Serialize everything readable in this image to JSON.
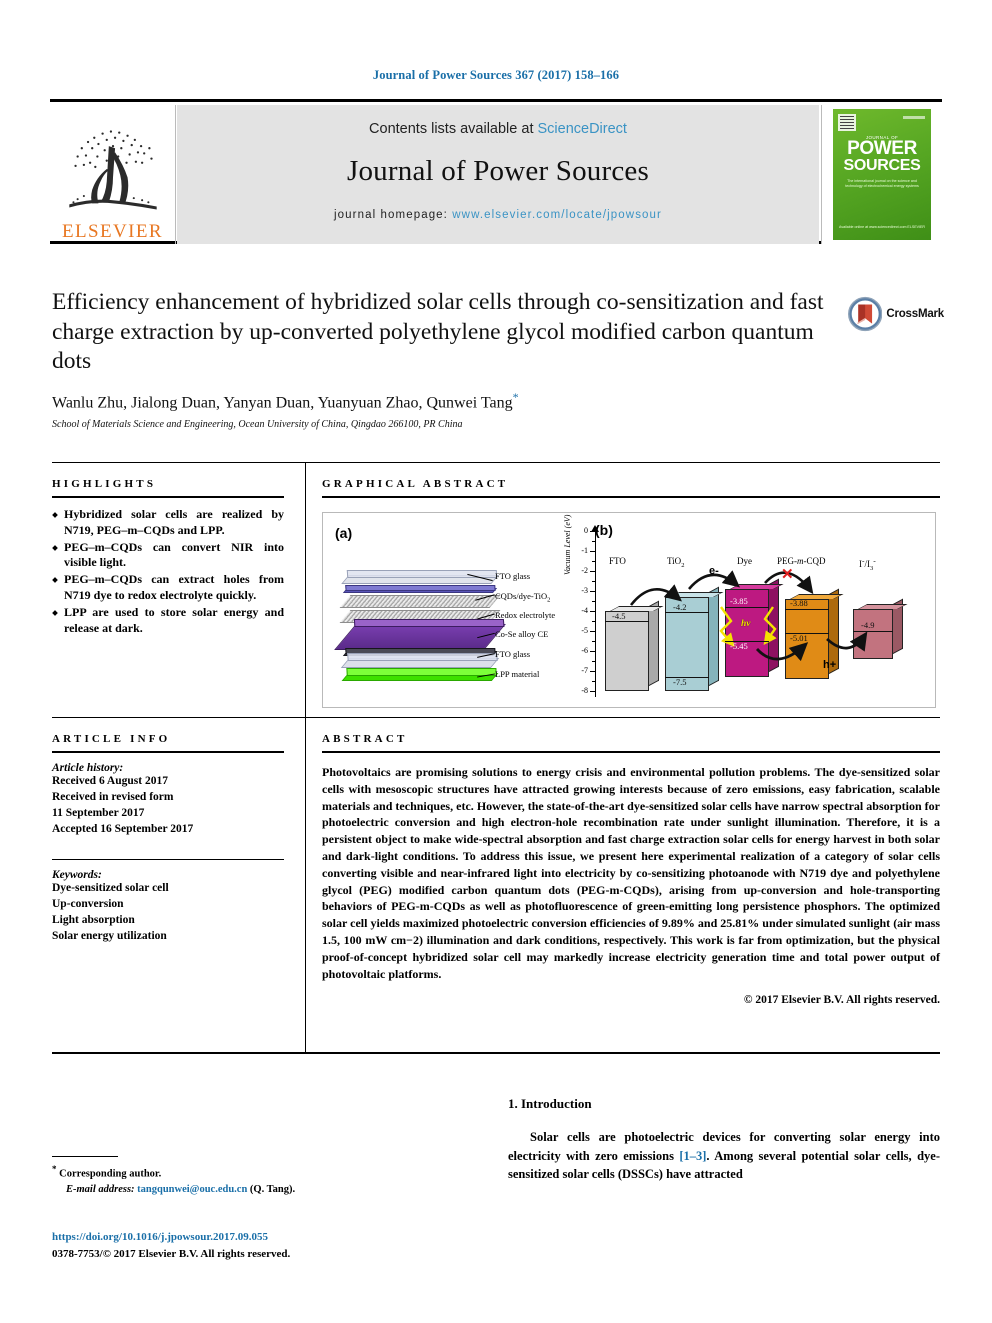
{
  "running_head": "Journal of Power Sources 367 (2017) 158–166",
  "masthead": {
    "elsevier_wordmark": "ELSEVIER",
    "contents_prefix": "Contents lists available at ",
    "contents_link": "ScienceDirect",
    "journal_name": "Journal of Power Sources",
    "homepage_prefix": "journal homepage: ",
    "homepage_url": "www.elsevier.com/locate/jpowsour",
    "cover": {
      "kicker": "JOURNAL OF",
      "title_line1": "POWER",
      "title_line2": "SOURCES",
      "subtitle": "The international journal on the science and technology of electrochemical energy systems",
      "footer": "Available online at www.sciencedirect.com\nELSEVIER"
    }
  },
  "article": {
    "title": "Efficiency enhancement of hybridized solar cells through co-sensitization and fast charge extraction by up-converted polyethylene glycol modified carbon quantum dots",
    "authors": "Wanlu Zhu, Jialong Duan, Yanyan Duan, Yuanyuan Zhao, Qunwei Tang",
    "corresponding_marker": "*",
    "affiliation": "School of Materials Science and Engineering, Ocean University of China, Qingdao 266100, PR China",
    "crossmark_label": "CrossMark"
  },
  "highlights": {
    "heading": "HIGHLIGHTS",
    "items": [
      "Hybridized solar cells are realized by N719, PEG–m–CQDs and LPP.",
      "PEG–m–CQDs can convert NIR into visible light.",
      "PEG–m–CQDs can extract holes from N719 dye to redox electrolyte quickly.",
      "LPP are used to store solar energy and release at dark."
    ]
  },
  "article_info": {
    "heading": "ARTICLE INFO",
    "history_label": "Article history:",
    "history": [
      "Received 6 August 2017",
      "Received in revised form",
      "11 September 2017",
      "Accepted 16 September 2017"
    ],
    "keywords_label": "Keywords:",
    "keywords": [
      "Dye-sensitized solar cell",
      "Up-conversion",
      "Light absorption",
      "Solar energy utilization"
    ]
  },
  "graphical_abstract": {
    "heading": "GRAPHICAL ABSTRACT",
    "panel_a": {
      "label": "(a)",
      "layer_labels": [
        "FTO glass",
        "CQDs/dye-TiO2",
        "Redox electrolyte",
        "Co-Se alloy CE",
        "FTO glass",
        "LPP material"
      ]
    },
    "panel_b": {
      "label": "(b)",
      "ylabel": "Vacuum Level (eV)",
      "ytick_labels": [
        "0",
        "-1",
        "-2",
        "-3",
        "-4",
        "-5",
        "-6",
        "-7",
        "-8"
      ],
      "columns": [
        "FTO",
        "TiO2",
        "Dye",
        "PEG-m-CQD",
        "I-/I3-"
      ],
      "levels": {
        "fto": "-4.5",
        "tio2": [
          "-4.2",
          "-7.5"
        ],
        "dye": [
          "-3.85",
          "-5.45"
        ],
        "cqd": [
          "-3.88",
          "-5.01"
        ],
        "redox": "-4.9"
      },
      "annotations": {
        "electron": "e-",
        "hole": "h+",
        "photon": "hv",
        "blocked": "✕"
      }
    }
  },
  "abstract": {
    "heading": "ABSTRACT",
    "body": "Photovoltaics are promising solutions to energy crisis and environmental pollution problems. The dye-sensitized solar cells with mesoscopic structures have attracted growing interests because of zero emissions, easy fabrication, scalable materials and techniques, etc. However, the state-of-the-art dye-sensitized solar cells have narrow spectral absorption for photoelectric conversion and high electron-hole recombination rate under sunlight illumination. Therefore, it is a persistent object to make wide-spectral absorption and fast charge extraction solar cells for energy harvest in both solar and dark-light conditions. To address this issue, we present here experimental realization of a category of solar cells converting visible and near-infrared light into electricity by co-sensitizing photoanode with N719 dye and polyethylene glycol (PEG) modified carbon quantum dots (PEG-m-CQDs), arising from up-conversion and hole-transporting behaviors of PEG-m-CQDs as well as photofluorescence of green-emitting long persistence phosphors. The optimized solar cell yields maximized photoelectric conversion efficiencies of 9.89% and 25.81% under simulated sunlight (air mass 1.5, 100 mW cm−2) illumination and dark conditions, respectively. This work is far from optimization, but the physical proof-of-concept hybridized solar cell may markedly increase electricity generation time and total power output of photovoltaic platforms.",
    "copyright": "© 2017 Elsevier B.V. All rights reserved."
  },
  "introduction": {
    "heading": "1.  Introduction",
    "paragraph_1": "Solar cells are photoelectric devices for converting solar energy into electricity with zero emissions ",
    "citation": "[1–3]",
    "paragraph_2": ". Among several potential solar cells, dye-sensitized solar cells (DSSCs) have attracted"
  },
  "footer": {
    "corresponding_marker": "*",
    "corresponding_label": "Corresponding author.",
    "email_label": "E-mail address:",
    "email": "tangqunwei@ouc.edu.cn",
    "email_owner": "(Q. Tang).",
    "doi": "https://doi.org/10.1016/j.jpowsour.2017.09.055",
    "issn_line": "0378-7753/© 2017 Elsevier B.V. All rights reserved."
  },
  "colors": {
    "link_blue": "#1a6fa8",
    "sciencedirect_blue": "#3a93c4",
    "elsevier_orange": "#E87722",
    "cover_green": "#57a723"
  }
}
